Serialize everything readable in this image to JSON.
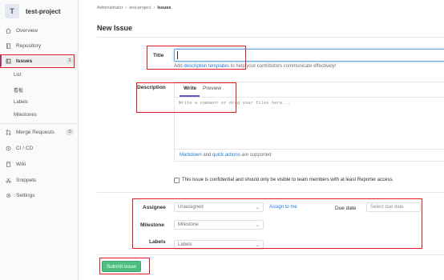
{
  "project": {
    "avatar_letter": "T",
    "name": "test-project"
  },
  "sidebar": {
    "items": [
      {
        "label": "Overview",
        "icon": "home-icon"
      },
      {
        "label": "Repository",
        "icon": "book-icon"
      },
      {
        "label": "Issues",
        "icon": "issues-icon",
        "badge": "2"
      },
      {
        "label": "Merge Requests",
        "icon": "merge-request-icon",
        "badge": "0"
      },
      {
        "label": "CI / CD",
        "icon": "rocket-icon"
      },
      {
        "label": "Wiki",
        "icon": "book-open-icon"
      },
      {
        "label": "Snippets",
        "icon": "scissors-icon"
      },
      {
        "label": "Settings",
        "icon": "gear-icon"
      }
    ],
    "issue_subitems": [
      "List",
      "看板",
      "Labels",
      "Milestones"
    ]
  },
  "breadcrumb": [
    "Administrator",
    "test-project",
    "Issues"
  ],
  "page_title": "New Issue",
  "form": {
    "title_label": "Title",
    "help_prefix": "Add ",
    "help_link": "description templates",
    "help_suffix": " to help your contributors communicate effectively!",
    "description_label": "Description",
    "write_tab": "Write",
    "preview_tab": "Preview",
    "description_placeholder": "Write a comment or drag your files here...",
    "markdown_link": "Markdown",
    "and_text": " and ",
    "quick_actions_link": "quick actions",
    "supported_text": " are supported",
    "confidential_text": "This issue is confidential and should only be visible to team members with at least Reporter access.",
    "assignee_label": "Assignee",
    "assignee_value": "Unassigned",
    "assign_to_me": "Assign to me",
    "milestone_label": "Milestone",
    "milestone_value": "Milestone",
    "labels_label": "Labels",
    "labels_value": "Labels",
    "due_date_label": "Due date",
    "due_date_placeholder": "Select due date",
    "submit_label": "Submit issue"
  },
  "colors": {
    "accent": "#6b4fbb",
    "submit": "#4cbe80",
    "link": "#1f78d1",
    "annotation": "#e31c23"
  }
}
